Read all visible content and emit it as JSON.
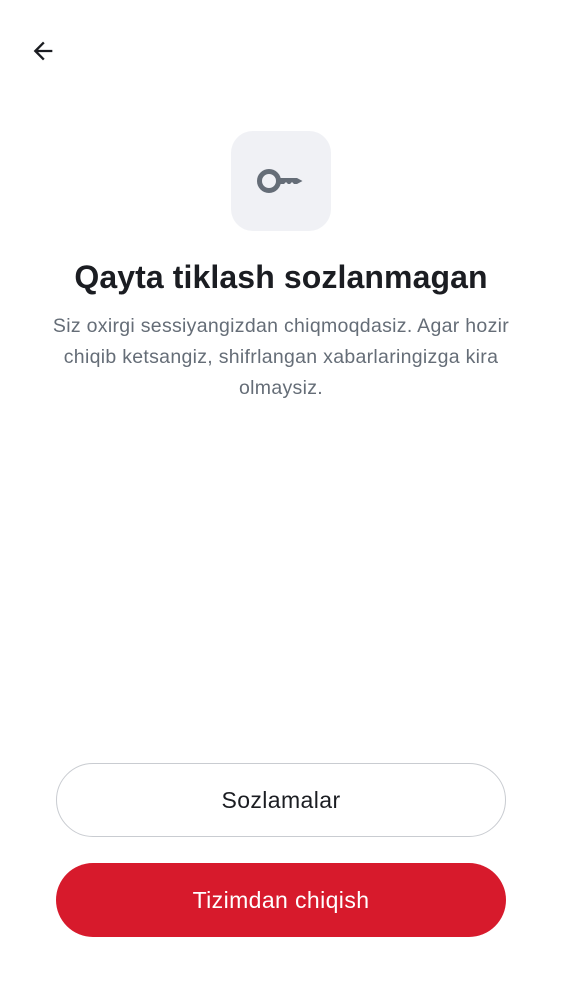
{
  "header": {
    "back_icon": "arrow-left-icon"
  },
  "hero": {
    "icon": "key-icon",
    "icon_color": "#656d77",
    "tile_color": "#f0f1f5"
  },
  "title": "Qayta tiklash sozlanmagan",
  "description": "Siz oxirgi sessiyangizdan chiqmoqdasiz. Agar hozir chiqib ketsangiz, shifrlangan xabarlaringizga kira olmaysiz.",
  "actions": {
    "settings_label": "Sozlamalar",
    "logout_label": "Tizimdan chiqish",
    "logout_color": "#d71a2c"
  }
}
